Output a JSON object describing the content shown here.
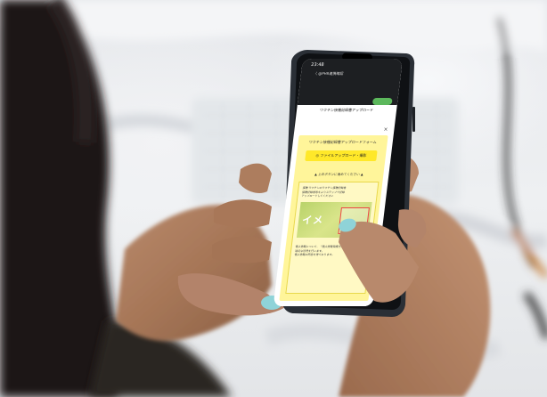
{
  "phone": {
    "status_time": "23:48",
    "chat_title": "〈 @PHR連携確認",
    "sheet_header": "ワクチン接種記録書アップロード",
    "panel_title": "ワクチン接種記録書アップロードフォーム",
    "upload_button": "ファイルアップロード・撮影",
    "hint": "▲ 上のボタンに進めてください ▲",
    "card_lines": [
      "接種 ワクチンのワクチン接種記録書",
      "接種記録書等をよりステップで記録",
      "アップロードしてください"
    ],
    "image_label": "イメ",
    "note_lines": [
      "個人情報について、「個人情報保護方針」に従い",
      "適切な管理を行います。",
      "個人情報の同意を得ております。"
    ]
  },
  "colors": {
    "panel_yellow": "#fff59a",
    "button_yellow": "#ffe829",
    "status_green": "#5cb85c",
    "nail_blue": "#8fd3d8"
  }
}
